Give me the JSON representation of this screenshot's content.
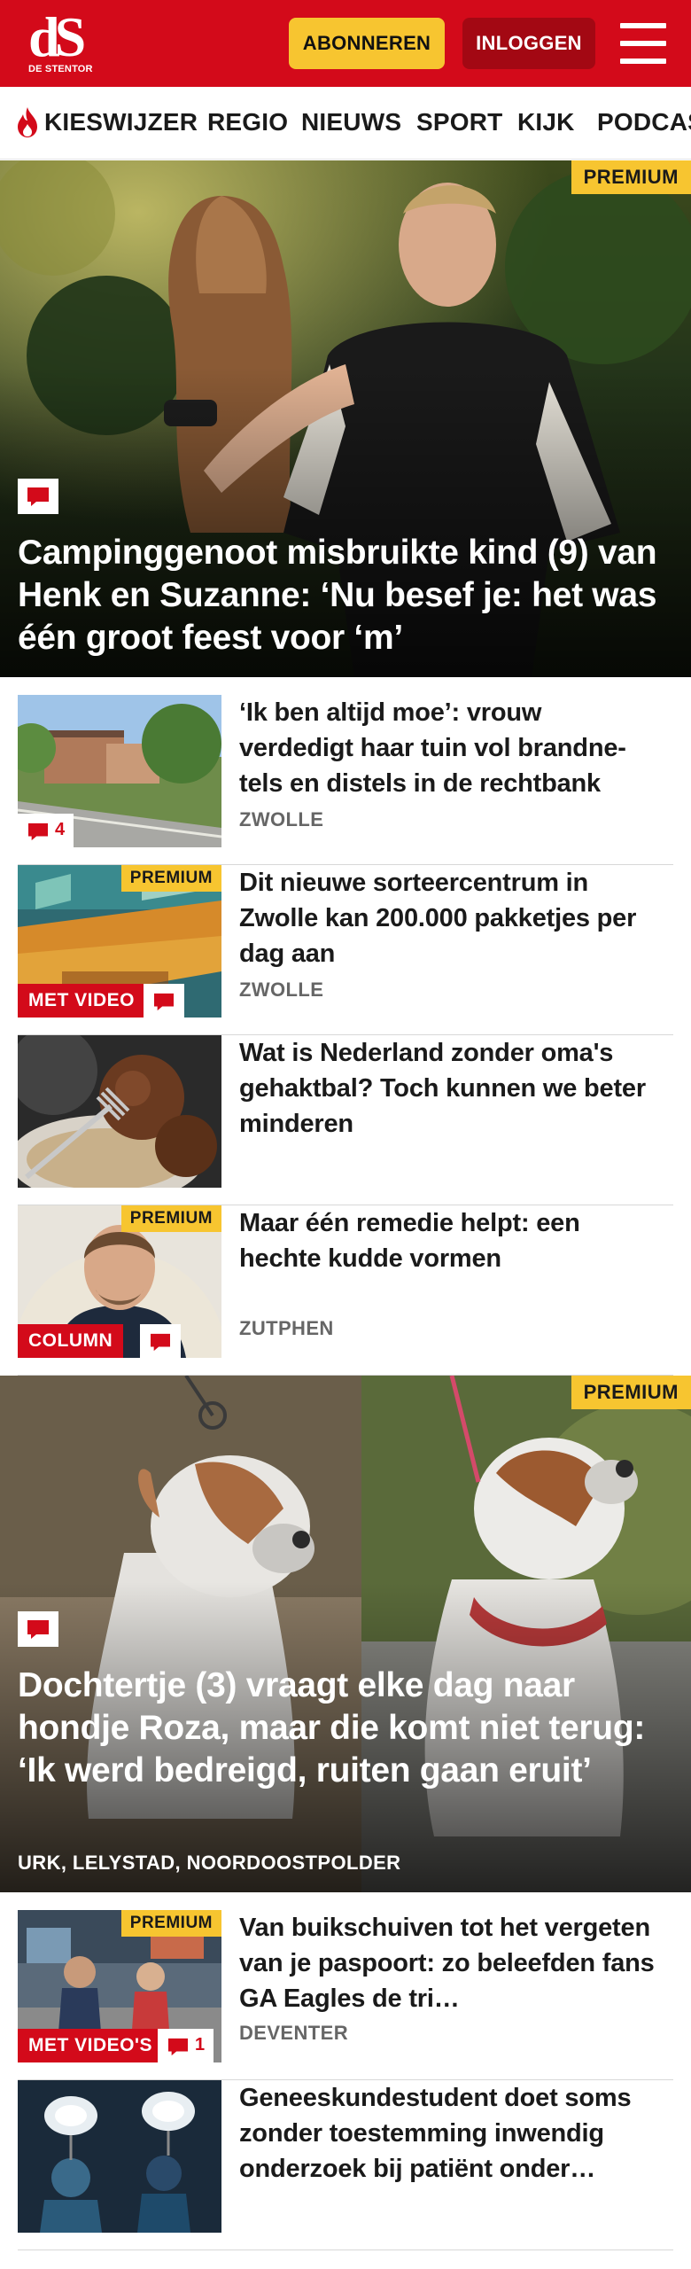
{
  "header": {
    "logo_mark": "dS",
    "logo_sub": "DE STENTOR",
    "subscribe_label": "ABONNEREN",
    "login_label": "INLOGGEN"
  },
  "nav": {
    "items": [
      "KIESWIJZER",
      "REGIO",
      "NIEUWS",
      "SPORT",
      "KIJK",
      "PODCAST"
    ]
  },
  "hero1": {
    "premium": "PREMIUM",
    "title": "Campinggenoot misbruikte kind (9) van Henk en Suzanne: ‘Nu besef je: het was één groot feest voor ‘m’"
  },
  "articles": [
    {
      "title": "‘Ik ben altijd moe’: vrouw verdedigt haar tuin vol brandne­tels en distels in de rechtbank",
      "location": "ZWOLLE",
      "comments": "4"
    },
    {
      "premium": "PREMIUM",
      "badge": "MET VIDEO",
      "title": "Dit nieuwe sorteercentrum in Zwolle kan 200.000 pakketjes per dag aan",
      "location": "ZWOLLE"
    },
    {
      "title": "Wat is Nederland zonder oma's gehaktbal? Toch kunnen we beter minderen"
    },
    {
      "premium": "PREMIUM",
      "badge": "COLUMN",
      "title": "Maar één remedie helpt: een hechte kudde vormen",
      "location": "ZUTPHEN"
    }
  ],
  "hero2": {
    "premium": "PREMIUM",
    "title": "Dochtertje (3) vraagt elke dag naar hondje Roza, maar die komt niet terug: ‘Ik werd bedreigd, ruiten gaan eruit’",
    "location": "URK, LELYSTAD, NOORDOOSTPOLDER"
  },
  "articles2": [
    {
      "premium": "PREMIUM",
      "badge": "MET VIDEO'S",
      "comments": "1",
      "title": "Van buikschuiven tot het vergeten van je paspoort: zo beleefden fans GA Eagles de tri…",
      "location": "DEVENTER"
    },
    {
      "title": "Geneeskundestudent doet soms zonder toestemming inwendig onderzoek bij patiënt onder…"
    }
  ],
  "colors": {
    "brand_red": "#d30a1a",
    "premium_yellow": "#f7c530",
    "login_dark_red": "#a30813"
  },
  "icons": [
    "hamburger-menu-icon",
    "flame-icon",
    "comment-icon"
  ]
}
